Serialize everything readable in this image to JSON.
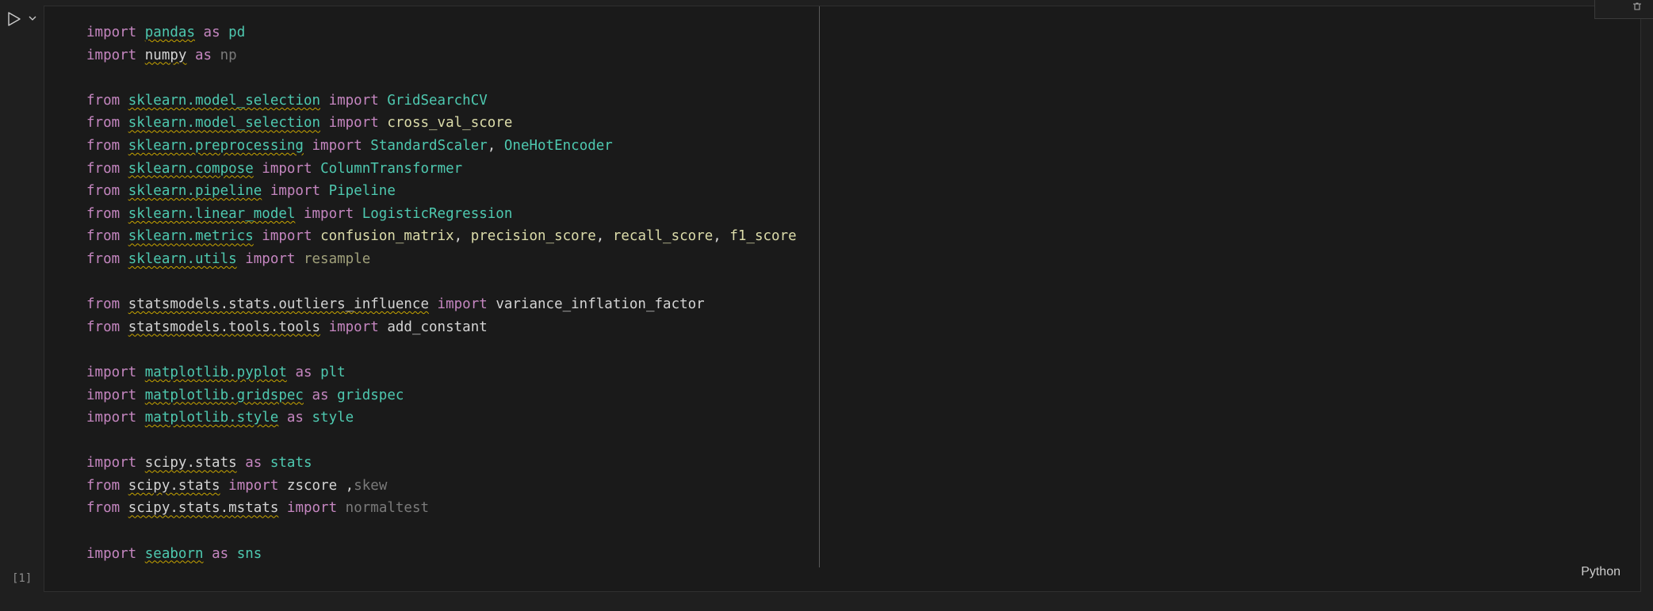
{
  "cell": {
    "execution_count": "[1]",
    "language": "Python",
    "run_icon": "play-icon",
    "run_menu_icon": "chevron-down-icon",
    "toolbar_icon": "delete-icon"
  },
  "code_lines": [
    [
      {
        "t": "import",
        "c": "kw"
      },
      {
        "t": " ",
        "c": "plain"
      },
      {
        "t": "pandas",
        "c": "mod",
        "sq": true
      },
      {
        "t": " ",
        "c": "plain"
      },
      {
        "t": "as",
        "c": "kw"
      },
      {
        "t": " ",
        "c": "plain"
      },
      {
        "t": "pd",
        "c": "mod"
      }
    ],
    [
      {
        "t": "import",
        "c": "kw"
      },
      {
        "t": " ",
        "c": "plain"
      },
      {
        "t": "numpy",
        "c": "plain",
        "sq": true
      },
      {
        "t": " ",
        "c": "plain"
      },
      {
        "t": "as",
        "c": "kw"
      },
      {
        "t": " ",
        "c": "plain"
      },
      {
        "t": "np",
        "c": "dim"
      }
    ],
    [],
    [
      {
        "t": "from",
        "c": "kw"
      },
      {
        "t": " ",
        "c": "plain"
      },
      {
        "t": "sklearn.model_selection",
        "c": "mod",
        "sq": true
      },
      {
        "t": " ",
        "c": "plain"
      },
      {
        "t": "import",
        "c": "kw"
      },
      {
        "t": " ",
        "c": "plain"
      },
      {
        "t": "GridSearchCV",
        "c": "cls"
      }
    ],
    [
      {
        "t": "from",
        "c": "kw"
      },
      {
        "t": " ",
        "c": "plain"
      },
      {
        "t": "sklearn.model_selection",
        "c": "mod",
        "sq": true
      },
      {
        "t": " ",
        "c": "plain"
      },
      {
        "t": "import",
        "c": "kw"
      },
      {
        "t": " ",
        "c": "plain"
      },
      {
        "t": "cross_val_score",
        "c": "fn"
      }
    ],
    [
      {
        "t": "from",
        "c": "kw"
      },
      {
        "t": " ",
        "c": "plain"
      },
      {
        "t": "sklearn.preprocessing",
        "c": "mod",
        "sq": true
      },
      {
        "t": " ",
        "c": "plain"
      },
      {
        "t": "import",
        "c": "kw"
      },
      {
        "t": " ",
        "c": "plain"
      },
      {
        "t": "StandardScaler",
        "c": "cls"
      },
      {
        "t": ", ",
        "c": "plain"
      },
      {
        "t": "OneHotEncoder",
        "c": "cls"
      }
    ],
    [
      {
        "t": "from",
        "c": "kw"
      },
      {
        "t": " ",
        "c": "plain"
      },
      {
        "t": "sklearn.compose",
        "c": "mod",
        "sq": true
      },
      {
        "t": " ",
        "c": "plain"
      },
      {
        "t": "import",
        "c": "kw"
      },
      {
        "t": " ",
        "c": "plain"
      },
      {
        "t": "ColumnTransformer",
        "c": "cls"
      }
    ],
    [
      {
        "t": "from",
        "c": "kw"
      },
      {
        "t": " ",
        "c": "plain"
      },
      {
        "t": "sklearn.pipeline",
        "c": "mod",
        "sq": true
      },
      {
        "t": " ",
        "c": "plain"
      },
      {
        "t": "import",
        "c": "kw"
      },
      {
        "t": " ",
        "c": "plain"
      },
      {
        "t": "Pipeline",
        "c": "cls"
      }
    ],
    [
      {
        "t": "from",
        "c": "kw"
      },
      {
        "t": " ",
        "c": "plain"
      },
      {
        "t": "sklearn.linear_model",
        "c": "mod",
        "sq": true
      },
      {
        "t": " ",
        "c": "plain"
      },
      {
        "t": "import",
        "c": "kw"
      },
      {
        "t": " ",
        "c": "plain"
      },
      {
        "t": "LogisticRegression",
        "c": "cls"
      }
    ],
    [
      {
        "t": "from",
        "c": "kw"
      },
      {
        "t": " ",
        "c": "plain"
      },
      {
        "t": "sklearn.metrics",
        "c": "mod",
        "sq": true
      },
      {
        "t": " ",
        "c": "plain"
      },
      {
        "t": "import",
        "c": "kw"
      },
      {
        "t": " ",
        "c": "plain"
      },
      {
        "t": "confusion_matrix",
        "c": "fn"
      },
      {
        "t": ", ",
        "c": "plain"
      },
      {
        "t": "precision_score",
        "c": "fn"
      },
      {
        "t": ", ",
        "c": "plain"
      },
      {
        "t": "recall_score",
        "c": "fn"
      },
      {
        "t": ", ",
        "c": "plain"
      },
      {
        "t": "f1_score",
        "c": "fn"
      }
    ],
    [
      {
        "t": "from",
        "c": "kw"
      },
      {
        "t": " ",
        "c": "plain"
      },
      {
        "t": "sklearn.utils",
        "c": "mod",
        "sq": true
      },
      {
        "t": " ",
        "c": "plain"
      },
      {
        "t": "import",
        "c": "kw"
      },
      {
        "t": " ",
        "c": "plain"
      },
      {
        "t": "resample",
        "c": "dimfn"
      }
    ],
    [],
    [
      {
        "t": "from",
        "c": "kw"
      },
      {
        "t": " ",
        "c": "plain"
      },
      {
        "t": "statsmodels.stats.outliers_influence",
        "c": "plain",
        "sq": true
      },
      {
        "t": " ",
        "c": "plain"
      },
      {
        "t": "import",
        "c": "kw"
      },
      {
        "t": " ",
        "c": "plain"
      },
      {
        "t": "variance_inflation_factor",
        "c": "plain"
      }
    ],
    [
      {
        "t": "from",
        "c": "kw"
      },
      {
        "t": " ",
        "c": "plain"
      },
      {
        "t": "statsmodels.tools.tools",
        "c": "plain",
        "sq": true
      },
      {
        "t": " ",
        "c": "plain"
      },
      {
        "t": "import",
        "c": "kw"
      },
      {
        "t": " ",
        "c": "plain"
      },
      {
        "t": "add_constant",
        "c": "plain"
      }
    ],
    [],
    [
      {
        "t": "import",
        "c": "kw"
      },
      {
        "t": " ",
        "c": "plain"
      },
      {
        "t": "matplotlib.pyplot",
        "c": "mod",
        "sq": true
      },
      {
        "t": " ",
        "c": "plain"
      },
      {
        "t": "as",
        "c": "kw"
      },
      {
        "t": " ",
        "c": "plain"
      },
      {
        "t": "plt",
        "c": "mod"
      }
    ],
    [
      {
        "t": "import",
        "c": "kw"
      },
      {
        "t": " ",
        "c": "plain"
      },
      {
        "t": "matplotlib.gridspec",
        "c": "mod",
        "sq": true
      },
      {
        "t": " ",
        "c": "plain"
      },
      {
        "t": "as",
        "c": "kw"
      },
      {
        "t": " ",
        "c": "plain"
      },
      {
        "t": "gridspec",
        "c": "mod"
      }
    ],
    [
      {
        "t": "import",
        "c": "kw"
      },
      {
        "t": " ",
        "c": "plain"
      },
      {
        "t": "matplotlib.style",
        "c": "mod",
        "sq": true
      },
      {
        "t": " ",
        "c": "plain"
      },
      {
        "t": "as",
        "c": "kw"
      },
      {
        "t": " ",
        "c": "plain"
      },
      {
        "t": "style",
        "c": "mod"
      }
    ],
    [],
    [
      {
        "t": "import",
        "c": "kw"
      },
      {
        "t": " ",
        "c": "plain"
      },
      {
        "t": "scipy.stats",
        "c": "plain",
        "sq": true
      },
      {
        "t": " ",
        "c": "plain"
      },
      {
        "t": "as",
        "c": "kw"
      },
      {
        "t": " ",
        "c": "plain"
      },
      {
        "t": "stats",
        "c": "mod"
      }
    ],
    [
      {
        "t": "from",
        "c": "kw"
      },
      {
        "t": " ",
        "c": "plain"
      },
      {
        "t": "scipy.stats",
        "c": "plain",
        "sq": true
      },
      {
        "t": " ",
        "c": "plain"
      },
      {
        "t": "import",
        "c": "kw"
      },
      {
        "t": " ",
        "c": "plain"
      },
      {
        "t": "zscore",
        "c": "plain"
      },
      {
        "t": " ,",
        "c": "plain"
      },
      {
        "t": "skew",
        "c": "dim"
      }
    ],
    [
      {
        "t": "from",
        "c": "kw"
      },
      {
        "t": " ",
        "c": "plain"
      },
      {
        "t": "scipy.stats.mstats",
        "c": "plain",
        "sq": true
      },
      {
        "t": " ",
        "c": "plain"
      },
      {
        "t": "import",
        "c": "kw"
      },
      {
        "t": " ",
        "c": "plain"
      },
      {
        "t": "normaltest",
        "c": "dim"
      }
    ],
    [],
    [
      {
        "t": "import",
        "c": "kw"
      },
      {
        "t": " ",
        "c": "plain"
      },
      {
        "t": "seaborn",
        "c": "mod",
        "sq": true
      },
      {
        "t": " ",
        "c": "plain"
      },
      {
        "t": "as",
        "c": "kw"
      },
      {
        "t": " ",
        "c": "plain"
      },
      {
        "t": "sns",
        "c": "mod"
      }
    ]
  ]
}
